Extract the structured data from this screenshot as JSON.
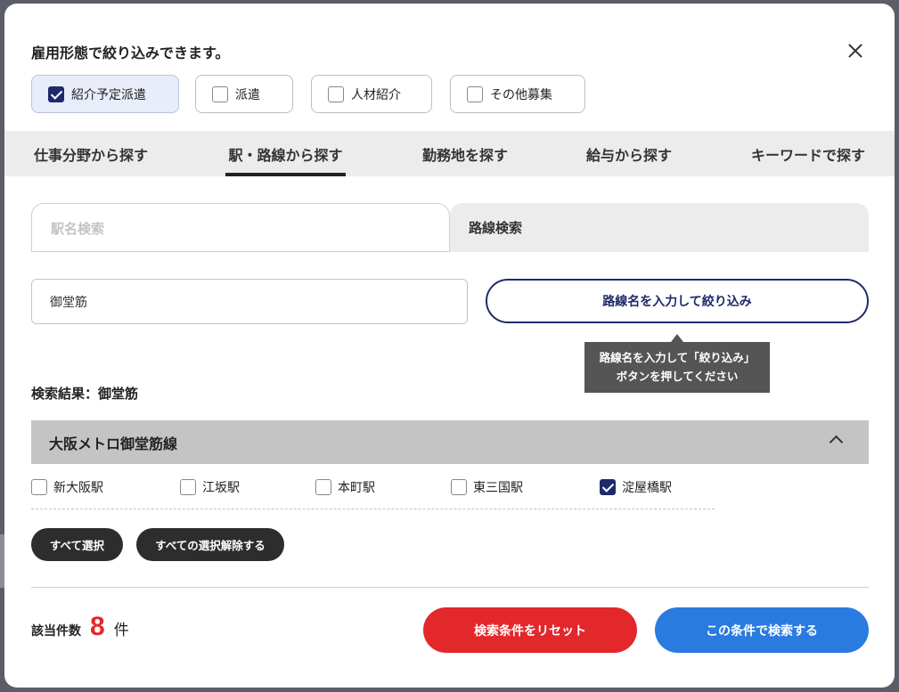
{
  "modal": {
    "title": "雇用形態で絞り込みできます。"
  },
  "employment_types": [
    {
      "label": "紹介予定派遣",
      "checked": true
    },
    {
      "label": "派遣",
      "checked": false
    },
    {
      "label": "人材紹介",
      "checked": false
    },
    {
      "label": "その他募集",
      "checked": false
    }
  ],
  "tabs": [
    {
      "label": "仕事分野から探す",
      "active": false
    },
    {
      "label": "駅・路線から探す",
      "active": true
    },
    {
      "label": "勤務地を探す",
      "active": false
    },
    {
      "label": "給与から探す",
      "active": false
    },
    {
      "label": "キーワードで探す",
      "active": false
    }
  ],
  "subtabs": {
    "station_search": "駅名検索",
    "line_search": "路線検索",
    "active": "line_search"
  },
  "line_filter": {
    "input_value": "御堂筋",
    "button_label": "路線名を入力して絞り込み",
    "tooltip_line1": "路線名を入力して「絞り込み」",
    "tooltip_line2": "ボタンを押してください"
  },
  "results": {
    "label": "検索結果：御堂筋",
    "line_name": "大阪メトロ御堂筋線",
    "expanded": true,
    "stations": [
      {
        "label": "新大阪駅",
        "checked": false
      },
      {
        "label": "江坂駅",
        "checked": false
      },
      {
        "label": "本町駅",
        "checked": false
      },
      {
        "label": "東三国駅",
        "checked": false
      },
      {
        "label": "淀屋橋駅",
        "checked": true
      }
    ],
    "select_all": "すべて選択",
    "deselect_all": "すべての選択解除する"
  },
  "footer": {
    "count_label": "該当件数",
    "count_value": "8",
    "count_unit": "件",
    "reset_label": "検索条件をリセット",
    "search_label": "この条件で検索する"
  },
  "colors": {
    "navy": "#1f2a6b",
    "red": "#e3282c",
    "blue": "#2a7be0",
    "dark": "#2d2d2d"
  },
  "icons": {
    "close": "close-icon",
    "chevron": "chevron-up-icon",
    "check": "checkmark-icon"
  }
}
